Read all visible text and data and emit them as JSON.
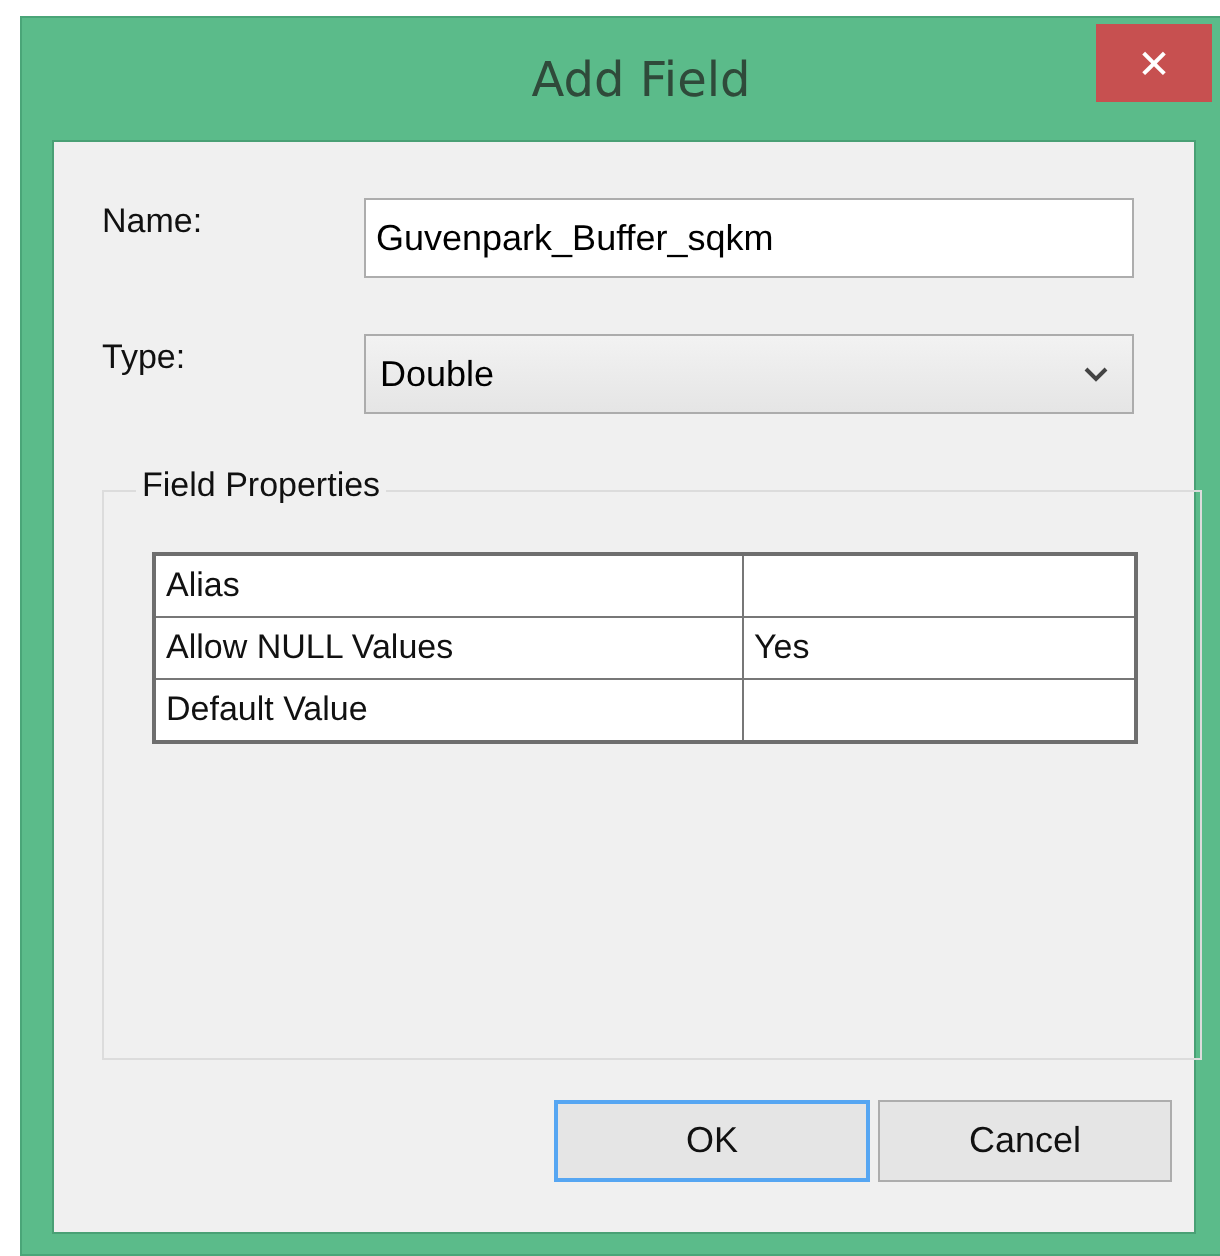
{
  "window": {
    "title": "Add Field",
    "close_glyph": "✕"
  },
  "name_field": {
    "label": "Name:",
    "value": "Guvenpark_Buffer_sqkm"
  },
  "type_field": {
    "label": "Type:",
    "value": "Double"
  },
  "field_properties": {
    "title": "Field Properties",
    "rows": [
      {
        "property": "Alias",
        "value": ""
      },
      {
        "property": "Allow NULL Values",
        "value": "Yes"
      },
      {
        "property": "Default Value",
        "value": ""
      }
    ]
  },
  "buttons": [
    {
      "label": "OK",
      "focused": true
    },
    {
      "label": "Cancel",
      "focused": false
    }
  ]
}
